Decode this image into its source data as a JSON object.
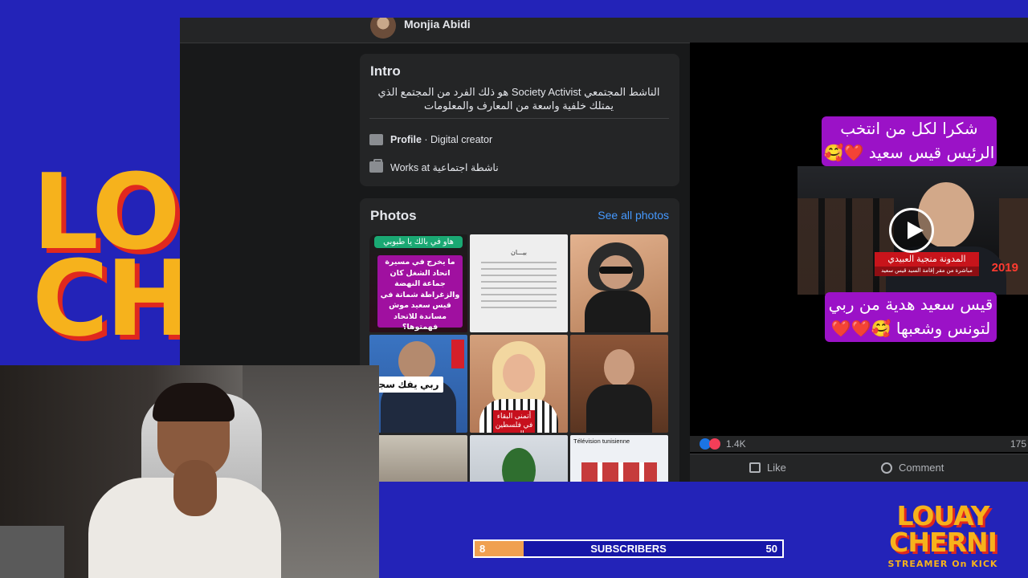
{
  "background_logo": {
    "lines": [
      "LO",
      "CH"
    ]
  },
  "profile": {
    "name": "Monjia Abidi"
  },
  "intro": {
    "title": "Intro",
    "bio": "الناشط المجتمعي Society Activist هو ذلك الفرد من المجتمع الذي يمتلك خلفية واسعة من المعارف والمعلومات",
    "rows": [
      {
        "icon": "profile-icon",
        "bold": "Profile",
        "text": " · Digital creator"
      },
      {
        "icon": "briefcase-icon",
        "bold": "Works at",
        "text": " ناشطة اجتماعية"
      }
    ]
  },
  "photos": {
    "title": "Photos",
    "see_all": "See all photos",
    "p1_tag": "هاو في بالك يا طبوبي",
    "p1_text": "ما يخرج في مسيرة اتحاد الشغل كان جماعة النهضة والزغراطة شماتة في قيس سعيد موش مساندة للاتحاد فهمتوها؟",
    "p2_title": "بيـــان",
    "p4_caption": "ربي يفك سجنك",
    "p5_caption": "أتمنى البقاء في فلسطين إلى حد",
    "p9_header": "Télévision tunisienne"
  },
  "post": {
    "overlay_top": "شكرا لكل من انتخب الرئيس قيس سعيد ❤️🥰🌹✨",
    "overlay_bottom": "قيس سعيد هدية من ربي لتونس وشعبها 🥰❤️❤️",
    "video_banner": "المدونة منجية العبيدي",
    "video_subbanner": "مباشرة من مقر إقامة السيد قيس سعيد",
    "video_year": "2019",
    "reactions_count": "1.4K",
    "comments_count": "175",
    "like_label": "Like",
    "comment_label": "Comment"
  },
  "subscribers": {
    "start": "8",
    "label": "SUBSCRIBERS",
    "goal": "50",
    "progress_fraction": 0.16
  },
  "brand": {
    "line1": "LOUAY",
    "line2": "CHERNI",
    "tagline": "STREAMER On KICK"
  },
  "colors": {
    "overlay_bg": "#2323b8",
    "logo_yellow": "#f6b21c",
    "logo_red": "#e0281e",
    "fb_link": "#4599ff",
    "progress_fill": "#f0a050"
  }
}
